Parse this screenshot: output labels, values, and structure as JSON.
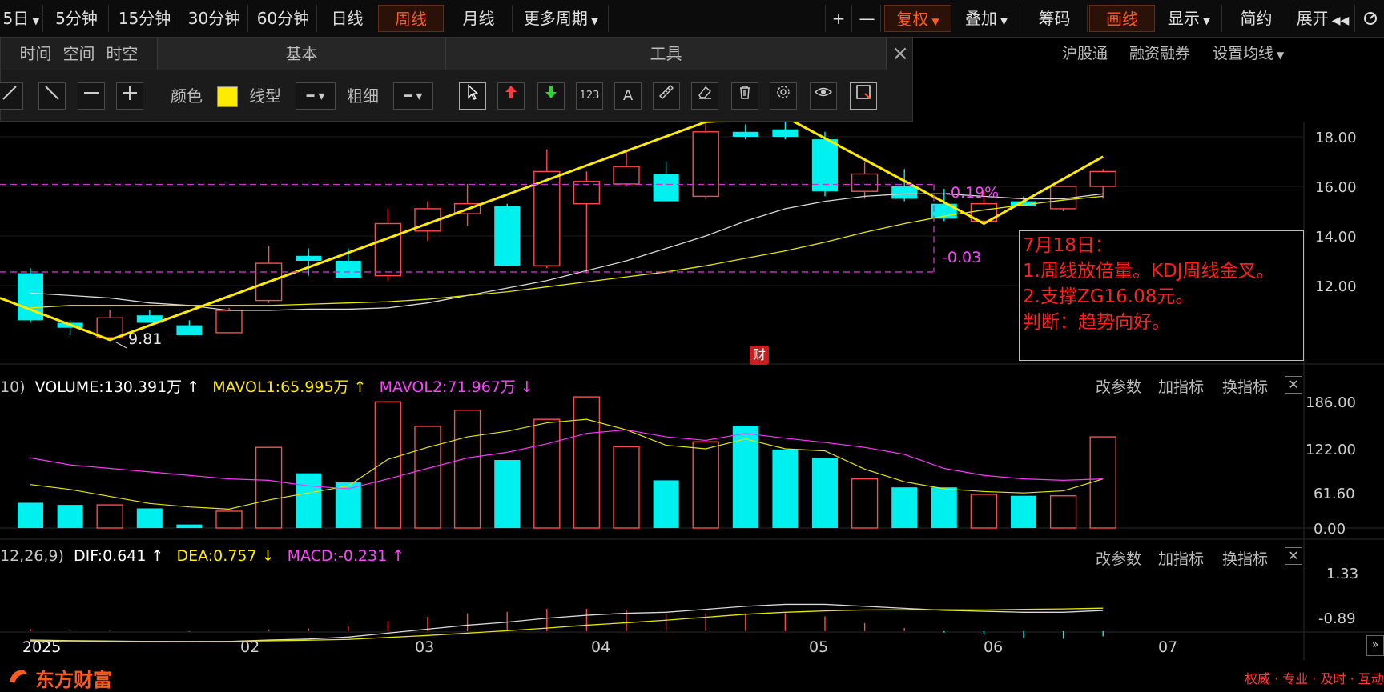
{
  "toolbar": {
    "period_partial": "5日",
    "periods": [
      "5分钟",
      "15分钟",
      "30分钟",
      "60分钟",
      "日线",
      "周线",
      "月线"
    ],
    "more_periods": "更多周期",
    "plus": "+",
    "minus": "—",
    "fuquan": "复权",
    "diejia": "叠加",
    "chouma": "筹码",
    "huaxian": "画线",
    "xianshi": "显示",
    "jianyue": "简约",
    "zhankai": "展开"
  },
  "panel": {
    "tabs": [
      "时间",
      "空间",
      "时空"
    ],
    "section_basic": "基本",
    "section_tools": "工具",
    "color_label": "颜色",
    "linetype_label": "线型",
    "width_label": "粗细",
    "selected_color": "#ffeb00",
    "tool_icons": [
      "cursor-icon",
      "arrow-up-icon",
      "arrow-down-icon",
      "number-icon",
      "text-icon",
      "ruler-icon",
      "eraser-icon",
      "trash-icon",
      "gear-icon",
      "eye-icon",
      "screenshot-icon"
    ],
    "number_tool_text": "123",
    "text_tool_text": "A"
  },
  "header_links": [
    "沪股通",
    "融资融券",
    "设置均线"
  ],
  "price_axis": [
    "18.00",
    "16.00",
    "14.00",
    "12.00"
  ],
  "annotations": {
    "low_price": "9.81",
    "pct_change": "-0.19%",
    "diff_change": "-0.03",
    "cai_badge": "财"
  },
  "annotation_box": {
    "lines": [
      "7月18日：",
      "1.周线放倍量。KDJ周线金叉。",
      "2.支撑ZG16.08元。",
      "判断：趋势向好。"
    ]
  },
  "volume_panel": {
    "prefix": "10)",
    "volume": "VOLUME:130.391万",
    "volume_arrow": "↑",
    "mavol1": "MAVOL1:65.995万",
    "mavol1_arrow": "↑",
    "mavol2": "MAVOL2:71.967万",
    "mavol2_arrow": "↓",
    "axis": [
      "186.00",
      "122.00",
      "61.60",
      "0.00"
    ],
    "actions": [
      "改参数",
      "加指标",
      "换指标"
    ]
  },
  "macd_panel": {
    "prefix": "12,26,9)",
    "dif": "DIF:0.641",
    "dif_arrow": "↑",
    "dea": "DEA:0.757",
    "dea_arrow": "↓",
    "macd": "MACD:-0.231",
    "macd_arrow": "↑",
    "axis": [
      "1.33",
      "-0.89"
    ],
    "actions": [
      "改参数",
      "加指标",
      "换指标"
    ]
  },
  "x_axis": [
    "2025",
    "02",
    "03",
    "04",
    "05",
    "06",
    "07"
  ],
  "footer": {
    "brand": "东方财富",
    "slogan": "权威 · 专业 · 及时 · 互动"
  },
  "chart_data": {
    "type": "candlestick",
    "period": "weekly",
    "y_range": [
      10.5,
      19.5
    ],
    "candles": [
      {
        "o": 12.5,
        "h": 12.7,
        "l": 10.5,
        "c": 10.6,
        "up": false
      },
      {
        "o": 10.5,
        "h": 10.6,
        "l": 10.0,
        "c": 10.3,
        "up": false
      },
      {
        "o": 9.9,
        "h": 11.0,
        "l": 9.81,
        "c": 10.7,
        "up": true
      },
      {
        "o": 10.8,
        "h": 11.0,
        "l": 10.5,
        "c": 10.5,
        "up": false
      },
      {
        "o": 10.4,
        "h": 10.6,
        "l": 10.1,
        "c": 10.0,
        "up": false
      },
      {
        "o": 10.1,
        "h": 11.1,
        "l": 10.1,
        "c": 11.0,
        "up": true
      },
      {
        "o": 11.4,
        "h": 13.6,
        "l": 11.3,
        "c": 12.9,
        "up": true
      },
      {
        "o": 13.2,
        "h": 13.5,
        "l": 12.4,
        "c": 13.0,
        "up": false
      },
      {
        "o": 13.0,
        "h": 13.5,
        "l": 12.3,
        "c": 12.3,
        "up": false
      },
      {
        "o": 12.4,
        "h": 15.1,
        "l": 12.2,
        "c": 14.5,
        "up": true
      },
      {
        "o": 14.2,
        "h": 15.4,
        "l": 13.8,
        "c": 15.1,
        "up": true
      },
      {
        "o": 14.9,
        "h": 16.1,
        "l": 14.4,
        "c": 15.3,
        "up": true
      },
      {
        "o": 15.2,
        "h": 15.3,
        "l": 12.8,
        "c": 12.8,
        "up": false
      },
      {
        "o": 12.8,
        "h": 17.5,
        "l": 12.7,
        "c": 16.6,
        "up": true
      },
      {
        "o": 15.3,
        "h": 16.6,
        "l": 12.5,
        "c": 16.2,
        "up": true
      },
      {
        "o": 16.1,
        "h": 17.4,
        "l": 16.0,
        "c": 16.8,
        "up": true
      },
      {
        "o": 16.5,
        "h": 17.0,
        "l": 15.4,
        "c": 15.4,
        "up": false
      },
      {
        "o": 15.6,
        "h": 19.0,
        "l": 15.5,
        "c": 18.2,
        "up": true
      },
      {
        "o": 18.2,
        "h": 18.5,
        "l": 17.9,
        "c": 18.0,
        "up": false
      },
      {
        "o": 18.3,
        "h": 18.7,
        "l": 17.9,
        "c": 18.0,
        "up": false
      },
      {
        "o": 17.9,
        "h": 18.2,
        "l": 15.6,
        "c": 15.8,
        "up": false
      },
      {
        "o": 15.8,
        "h": 17.0,
        "l": 15.5,
        "c": 16.5,
        "up": true
      },
      {
        "o": 16.0,
        "h": 16.7,
        "l": 15.4,
        "c": 15.5,
        "up": false
      },
      {
        "o": 15.3,
        "h": 15.9,
        "l": 14.6,
        "c": 14.7,
        "up": false
      },
      {
        "o": 14.6,
        "h": 15.8,
        "l": 14.5,
        "c": 15.3,
        "up": true
      },
      {
        "o": 15.4,
        "h": 15.6,
        "l": 15.2,
        "c": 15.2,
        "up": false
      },
      {
        "o": 15.1,
        "h": 16.0,
        "l": 15.0,
        "c": 16.0,
        "up": true
      },
      {
        "o": 16.0,
        "h": 16.7,
        "l": 15.5,
        "c": 16.6,
        "up": true
      }
    ],
    "ma_white": [
      11.7,
      11.6,
      11.5,
      11.3,
      11.2,
      11.0,
      11.0,
      11.05,
      11.05,
      11.1,
      11.3,
      11.6,
      11.9,
      12.2,
      12.6,
      13.0,
      13.5,
      14.0,
      14.6,
      15.1,
      15.4,
      15.6,
      15.7,
      15.7,
      15.6,
      15.5,
      15.5,
      15.7
    ],
    "ma_yellow": [
      11.1,
      11.2,
      11.2,
      11.2,
      11.2,
      11.2,
      11.2,
      11.25,
      11.3,
      11.35,
      11.45,
      11.6,
      11.75,
      11.95,
      12.15,
      12.35,
      12.55,
      12.8,
      13.1,
      13.4,
      13.75,
      14.15,
      14.5,
      14.8,
      15.05,
      15.25,
      15.45,
      15.6
    ],
    "volume": [
      36,
      33,
      33,
      28,
      5,
      24,
      115,
      78,
      65,
      180,
      145,
      168,
      97,
      155,
      187,
      116,
      68,
      123,
      146,
      112,
      100,
      70,
      58,
      58,
      48,
      46,
      46,
      130
    ],
    "mavol1": [
      62,
      55,
      45,
      35,
      30,
      27,
      40,
      50,
      60,
      98,
      115,
      130,
      138,
      150,
      155,
      140,
      118,
      113,
      127,
      113,
      110,
      84,
      66,
      56,
      52,
      50,
      53,
      70
    ],
    "mavol2": [
      100,
      90,
      85,
      80,
      75,
      70,
      68,
      60,
      56,
      70,
      85,
      100,
      108,
      120,
      135,
      140,
      130,
      125,
      135,
      128,
      122,
      115,
      105,
      85,
      75,
      70,
      68,
      70
    ],
    "dif": [
      -0.85,
      -0.88,
      -0.9,
      -0.92,
      -0.93,
      -0.92,
      -0.85,
      -0.8,
      -0.7,
      -0.5,
      -0.3,
      -0.1,
      0.05,
      0.25,
      0.4,
      0.5,
      0.55,
      0.7,
      0.85,
      0.95,
      0.95,
      0.85,
      0.75,
      0.65,
      0.6,
      0.55,
      0.55,
      0.641
    ],
    "dea": [
      -0.9,
      -0.9,
      -0.91,
      -0.92,
      -0.92,
      -0.92,
      -0.89,
      -0.86,
      -0.82,
      -0.72,
      -0.62,
      -0.5,
      -0.38,
      -0.25,
      -0.1,
      0.02,
      0.15,
      0.3,
      0.45,
      0.55,
      0.62,
      0.67,
      0.68,
      0.68,
      0.67,
      0.7,
      0.72,
      0.757
    ],
    "macd_hist": [
      0.1,
      0.05,
      0.02,
      0.0,
      -0.02,
      0.0,
      0.08,
      0.12,
      0.22,
      0.44,
      0.64,
      0.8,
      0.86,
      1.0,
      1.0,
      0.96,
      0.8,
      0.8,
      0.8,
      0.8,
      0.66,
      0.36,
      0.14,
      -0.06,
      -0.14,
      -0.3,
      -0.34,
      -0.231
    ]
  }
}
